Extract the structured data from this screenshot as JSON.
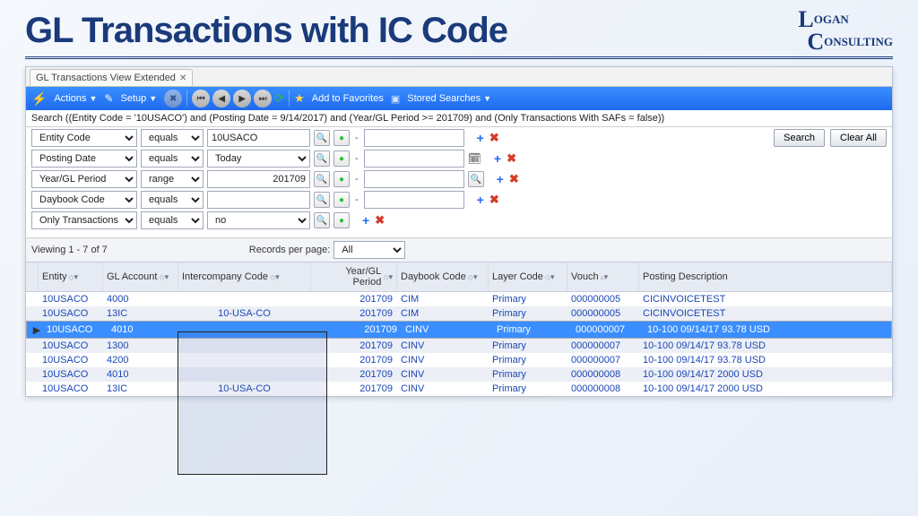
{
  "slide": {
    "title": "GL Transactions with IC Code",
    "logo_l1": "OGAN",
    "logo_l2": "ONSULTING"
  },
  "tab": {
    "label": "GL Transactions View Extended"
  },
  "toolbar": {
    "actions": "Actions",
    "setup": "Setup",
    "add_fav": "Add to Favorites",
    "stored": "Stored Searches"
  },
  "search": {
    "summary": "Search ((Entity Code = '10USACO') and (Posting Date = 9/14/2017) and (Year/GL Period >= 201709) and (Only Transactions With SAFs = false))",
    "btn_search": "Search",
    "btn_clear": "Clear All",
    "rows": [
      {
        "field": "Entity Code",
        "op": "equals",
        "v1": "10USACO",
        "v2": ""
      },
      {
        "field": "Posting Date",
        "op": "equals",
        "v1": "Today",
        "v2": ""
      },
      {
        "field": "Year/GL Period",
        "op": "range",
        "v1": "201709",
        "v2": ""
      },
      {
        "field": "Daybook Code",
        "op": "equals",
        "v1": "",
        "v2": ""
      },
      {
        "field": "Only Transactions Wi",
        "op": "equals",
        "v1": "no",
        "v2": ""
      }
    ]
  },
  "grid": {
    "viewing": "Viewing  1 - 7  of  7",
    "rpp_label": "Records per page:",
    "rpp_value": "All",
    "headers": {
      "entity": "Entity",
      "acc": "GL Account",
      "ic": "Intercompany Code",
      "year": "Year/GL Period",
      "day": "Daybook Code",
      "lay": "Layer Code",
      "vouch": "Vouch",
      "desc": "Posting Description"
    },
    "rows": [
      {
        "ent": "10USACO",
        "acc": "4000",
        "ic": "",
        "yr": "201709",
        "day": "CIM",
        "lay": "Primary",
        "v": "000000005",
        "d": "CICINVOICETEST"
      },
      {
        "ent": "10USACO",
        "acc": "13IC",
        "ic": "10-USA-CO",
        "yr": "201709",
        "day": "CIM",
        "lay": "Primary",
        "v": "000000005",
        "d": "CICINVOICETEST"
      },
      {
        "ent": "10USACO",
        "acc": "4010",
        "ic": "",
        "yr": "201709",
        "day": "CINV",
        "lay": "Primary",
        "v": "000000007",
        "d": "10-100 09/14/17 93.78 USD"
      },
      {
        "ent": "10USACO",
        "acc": "1300",
        "ic": "",
        "yr": "201709",
        "day": "CINV",
        "lay": "Primary",
        "v": "000000007",
        "d": "10-100 09/14/17 93.78 USD"
      },
      {
        "ent": "10USACO",
        "acc": "4200",
        "ic": "",
        "yr": "201709",
        "day": "CINV",
        "lay": "Primary",
        "v": "000000007",
        "d": "10-100 09/14/17 93.78 USD"
      },
      {
        "ent": "10USACO",
        "acc": "4010",
        "ic": "",
        "yr": "201709",
        "day": "CINV",
        "lay": "Primary",
        "v": "000000008",
        "d": "10-100 09/14/17 2000 USD"
      },
      {
        "ent": "10USACO",
        "acc": "13IC",
        "ic": "10-USA-CO",
        "yr": "201709",
        "day": "CINV",
        "lay": "Primary",
        "v": "000000008",
        "d": "10-100 09/14/17 2000 USD"
      }
    ],
    "selected": 2
  }
}
